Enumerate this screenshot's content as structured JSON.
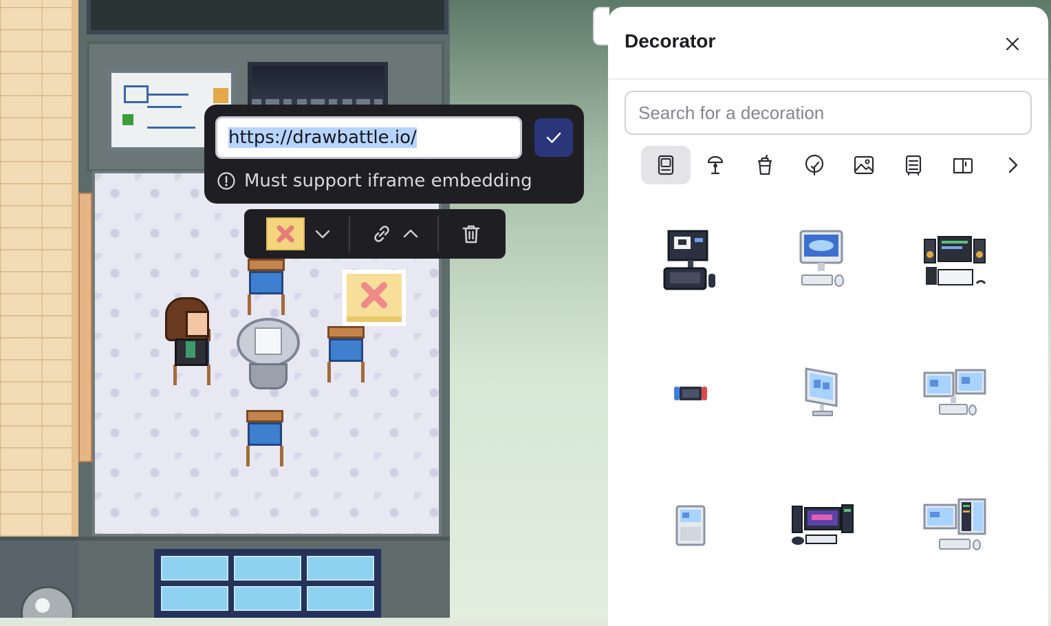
{
  "url_popover": {
    "url_value": "https://drawbattle.io/",
    "hint": "Must support iframe embedding",
    "confirm_color": "#2b357a"
  },
  "object_toolbar": {
    "items": [
      "embed-thumbnail",
      "chevron-down-icon",
      "link-icon",
      "chevron-up-icon",
      "trash-icon"
    ]
  },
  "decorator": {
    "title": "Decorator",
    "search_placeholder": "Search for a decoration",
    "categories": [
      "tech",
      "lamp",
      "cup",
      "plant",
      "picture",
      "shelf",
      "book"
    ],
    "active_category": "tech",
    "items": [
      "computer-workstation-icon",
      "imac-desktop-icon",
      "music-studio-icon",
      "game-console-icon",
      "single-monitor-icon",
      "dual-monitor-icon",
      "tablet-keyboard-icon",
      "gaming-setup-icon",
      "dual-monitor-server-icon"
    ]
  },
  "colors": {
    "panel_bg": "#ffffff",
    "toolbar_bg": "#1f1f23",
    "accent": "#2b357a"
  }
}
